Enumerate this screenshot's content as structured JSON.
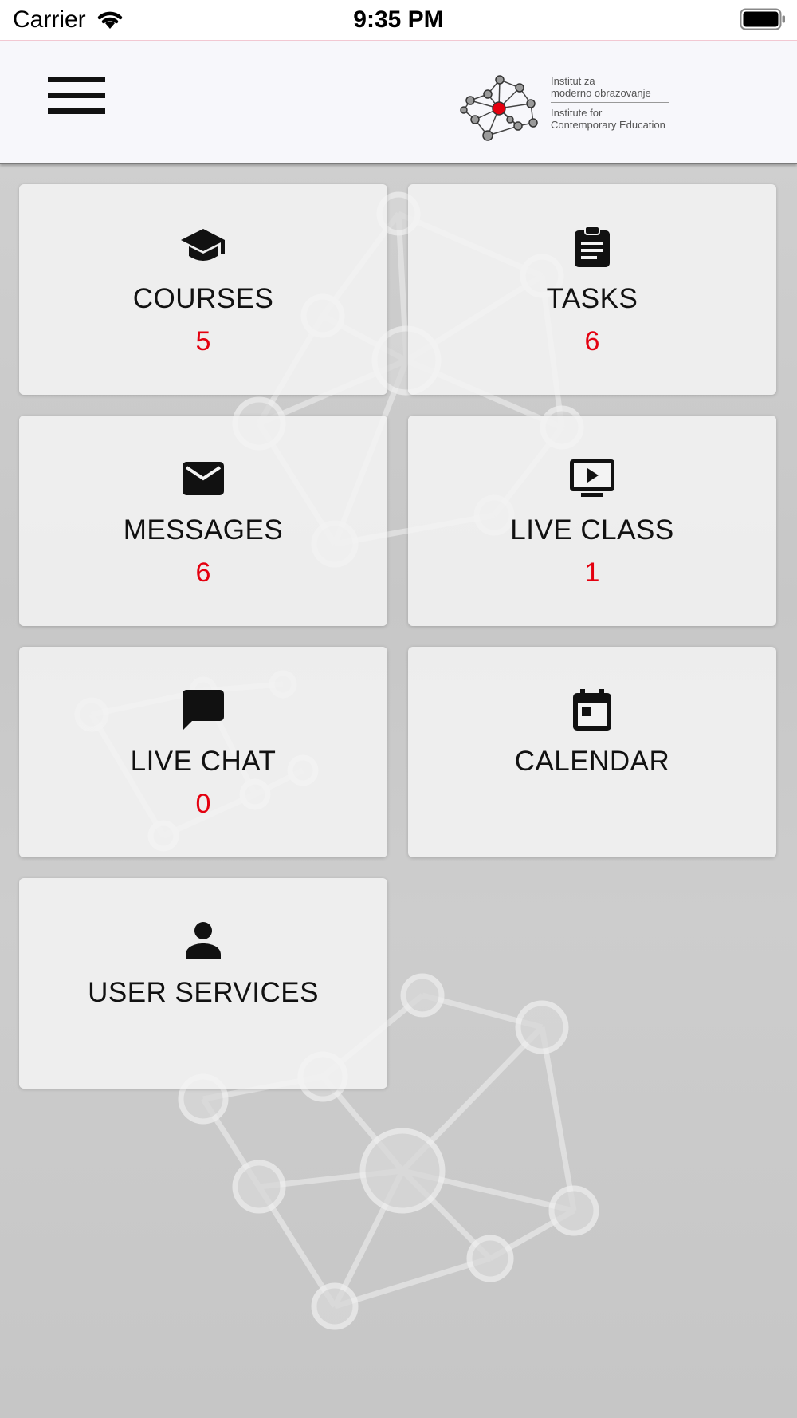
{
  "status_bar": {
    "carrier": "Carrier",
    "time": "9:35 PM"
  },
  "header": {
    "logo": {
      "line1": "Institut za",
      "line2": "moderno obrazovanje",
      "line3": "Institute for",
      "line4": "Contemporary Education"
    }
  },
  "tiles": [
    {
      "label": "COURSES",
      "count": "5",
      "icon": "graduation-cap-icon"
    },
    {
      "label": "TASKS",
      "count": "6",
      "icon": "clipboard-icon"
    },
    {
      "label": "MESSAGES",
      "count": "6",
      "icon": "envelope-icon"
    },
    {
      "label": "LIVE CLASS",
      "count": "1",
      "icon": "tv-play-icon"
    },
    {
      "label": "LIVE CHAT",
      "count": "0",
      "icon": "chat-bubble-icon"
    },
    {
      "label": "CALENDAR",
      "icon": "calendar-icon"
    },
    {
      "label": "USER SERVICES",
      "icon": "person-icon"
    }
  ],
  "colors": {
    "count": "#e4000f",
    "logo_dot": "#e4000f",
    "header_bg": "#f7f7fb"
  }
}
